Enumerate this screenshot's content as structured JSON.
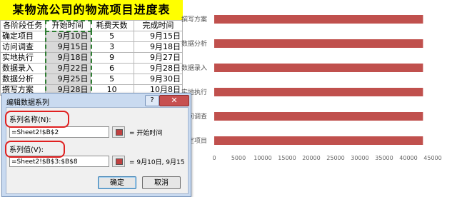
{
  "sheet": {
    "title": "某物流公司的物流项目进度表",
    "headers": [
      "各阶段任务",
      "开始时间",
      "耗费天数",
      "完成时间"
    ],
    "rows": [
      [
        "确定项目",
        "9月10日",
        "5",
        "9月15日"
      ],
      [
        "访问调查",
        "9月15日",
        "3",
        "9月18日"
      ],
      [
        "实地执行",
        "9月18日",
        "9",
        "9月27日"
      ],
      [
        "数据录入",
        "9月22日",
        "6",
        "9月28日"
      ],
      [
        "数据分析",
        "9月25日",
        "5",
        "9月30日"
      ],
      [
        "撰写方案",
        "9月28日",
        "10",
        "10月8日"
      ]
    ]
  },
  "chart_data": {
    "type": "bar",
    "orientation": "horizontal",
    "categories": [
      "撰写方案",
      "数据分析",
      "数据录入",
      "实地执行",
      "访问调查",
      "确定项目"
    ],
    "series": [
      {
        "values": [
          43006,
          43003,
          43000,
          42996,
          42993,
          42988
        ],
        "color": "#c0504d"
      }
    ],
    "xticks": [
      0,
      5000,
      10000,
      15000,
      20000,
      25000,
      30000,
      35000,
      40000,
      45000
    ],
    "xlim": [
      0,
      45000
    ],
    "category_labels_shown": [
      "撰写方案",
      "数据分析",
      "数据录入",
      "实地执行",
      "访问调查",
      "确定项目"
    ],
    "grid": false
  },
  "dialog": {
    "title": "编辑数据系列",
    "help": "?",
    "close": "✕",
    "series_name_label": "系列名称(N):",
    "series_name_value": "=Sheet2!$B$2",
    "series_name_preview": "= 开始时间",
    "series_values_label": "系列值(V):",
    "series_values_value": "=Sheet2!$B$3:$B$8",
    "series_values_preview": "= 9月10日, 9月15",
    "ok": "确定",
    "cancel": "取消"
  },
  "colors": {
    "title_bg": "#ffff00",
    "bar": "#c0504d",
    "highlight": "#e02020",
    "marquee": "#2e7d32"
  }
}
